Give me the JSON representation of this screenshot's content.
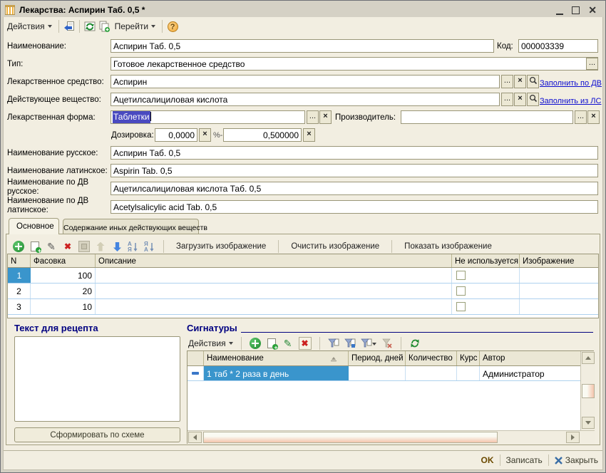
{
  "window": {
    "title": "Лекарства: Аспирин Таб. 0,5 *",
    "close_glyph": "✕"
  },
  "toolbar": {
    "actions": "Действия",
    "goto": "Перейти",
    "help": "?"
  },
  "ui": {
    "ellipsis": "...",
    "x": "×",
    "sort_a": "А",
    "sort_z": "Я"
  },
  "fields": {
    "name": {
      "label": "Наименование:",
      "value": "Аспирин Таб. 0,5"
    },
    "code": {
      "label": "Код:",
      "value": "000003339"
    },
    "type": {
      "label": "Тип:",
      "value": "Готовое лекарственное средство"
    },
    "drug": {
      "label": "Лекарственное средство:",
      "value": "Аспирин",
      "link": "Заполнить по ДВ"
    },
    "substance": {
      "label": "Действующее вещество:",
      "value": "Ацетилсалициловая кислота",
      "link": "Заполнить из ЛС"
    },
    "form": {
      "label": "Лекарственная форма:",
      "value": "Таблетки"
    },
    "manufacturer": {
      "label": "Производитель:",
      "value": ""
    },
    "dosage": {
      "label": "Дозировка:",
      "value1": "0,0000",
      "unit": "%-",
      "value2": "0,500000"
    },
    "name_ru": {
      "label": "Наименование русское:",
      "value": "Аспирин Таб. 0,5"
    },
    "name_lat": {
      "label": "Наименование латинское:",
      "value": "Aspirin Tab. 0,5"
    },
    "name_dv_ru": {
      "label1": "Наименование по ДВ",
      "label2": "русское:",
      "value": "Ацетилсалициловая кислота Таб. 0,5"
    },
    "name_dv_lat": {
      "label1": "Наименование по ДВ",
      "label2": "латинское:",
      "value": "Acetylsalicylic acid Tab. 0,5"
    }
  },
  "tabs": {
    "main": "Основное",
    "other": "Содержание иных действующих веществ"
  },
  "packaging": {
    "buttons": {
      "load": "Загрузить изображение",
      "clear": "Очистить изображение",
      "show": "Показать изображение"
    },
    "columns": {
      "n": "N",
      "pack": "Фасовка",
      "descr": "Описание",
      "unused": "Не используется",
      "image": "Изображение"
    },
    "rows": [
      {
        "n": "1",
        "pack": "100"
      },
      {
        "n": "2",
        "pack": "20"
      },
      {
        "n": "3",
        "pack": "10"
      }
    ]
  },
  "recipe": {
    "title": "Текст для рецепта",
    "button": "Сформировать по схеме"
  },
  "signatures": {
    "title": "Сигнатуры",
    "actions": "Действия",
    "columns": {
      "name": "Наименование",
      "period": "Период, дней",
      "qty": "Количество",
      "course": "Курс",
      "author": "Автор"
    },
    "rows": [
      {
        "name": "1 таб * 2 раза в день",
        "author": "Администратор"
      }
    ]
  },
  "statusbar": {
    "ok": "OK",
    "save": "Записать",
    "close": "Закрыть"
  }
}
